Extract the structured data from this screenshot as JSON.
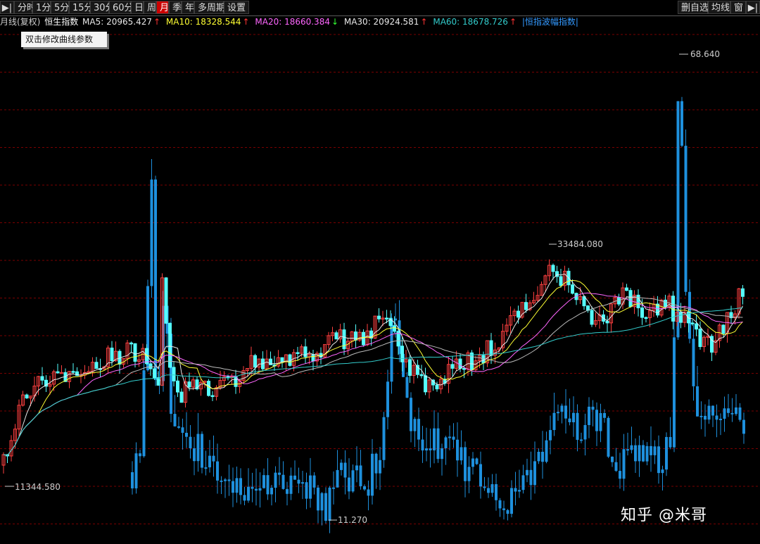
{
  "toolbar": {
    "left_buttons": [
      "分时",
      "1分",
      "5分",
      "15分",
      "30分",
      "60分",
      "日",
      "周",
      "月",
      "季",
      "年",
      "多周期",
      "设置"
    ],
    "active_label": "月",
    "right_buttons": [
      "删自选",
      "均线",
      "窗"
    ]
  },
  "ma_bar": {
    "period": "月线(复权)",
    "index_name": "恒生指数",
    "ma5": {
      "label": "MA5: 20965.427",
      "arrow": "↑",
      "color": "#e8e8e8"
    },
    "ma10": {
      "label": "MA10: 18328.544",
      "arrow": "↑",
      "color": "#ffff33"
    },
    "ma20": {
      "label": "MA20: 18660.384",
      "arrow": "↓",
      "color": "#ff66ff"
    },
    "ma30": {
      "label": "MA30: 20924.581",
      "arrow": "↑",
      "color": "#e8e8e8"
    },
    "ma60": {
      "label": "MA60: 18678.726",
      "arrow": "↑",
      "color": "#33cccc"
    },
    "overlay": "|恒指波幅指数|"
  },
  "tooltip": "双击修改曲线参数",
  "annotations": {
    "high_vhsi": "68.640",
    "high_hsi": "33484.080",
    "low_hsi": "11344.580",
    "low_vhsi": "11.270"
  },
  "watermark": "知乎 @米哥",
  "chart_data": {
    "type": "candlestick",
    "series": [
      {
        "name": "恒生指数",
        "high": 33484.08,
        "low": 11344.58
      },
      {
        "name": "恒指波幅指数",
        "high": 68.64,
        "low": 11.27
      }
    ],
    "moving_averages": [
      {
        "name": "MA5",
        "value": 20965.427
      },
      {
        "name": "MA10",
        "value": 18328.544
      },
      {
        "name": "MA20",
        "value": 18660.384
      },
      {
        "name": "MA30",
        "value": 20924.581
      },
      {
        "name": "MA60",
        "value": 18678.726
      }
    ],
    "grid": true
  },
  "colors": {
    "up": "#ff4040",
    "down": "#55ffff",
    "vhsi": "#1e90dd",
    "grid": "#7a0000"
  }
}
